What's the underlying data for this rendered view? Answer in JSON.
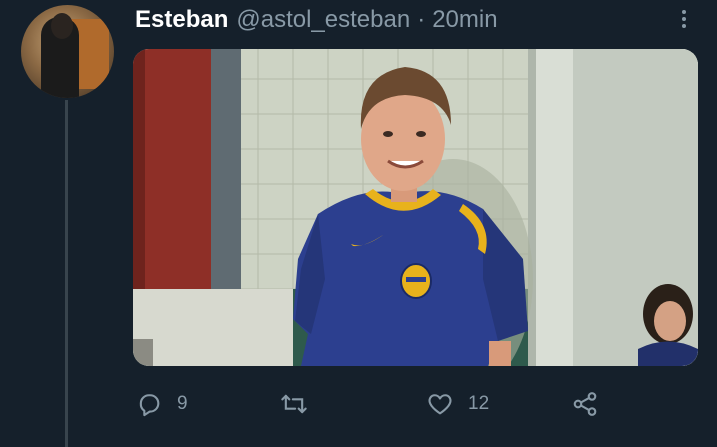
{
  "tweet": {
    "display_name": "Esteban",
    "handle": "@astol_esteban",
    "separator": "·",
    "time": "20min"
  },
  "avatar": {
    "icon": "profile-avatar"
  },
  "media": {
    "description_icon": "tweet-photo"
  },
  "actions": {
    "reply": {
      "icon": "reply-icon",
      "count": "9"
    },
    "retweet": {
      "icon": "retweet-icon",
      "count": ""
    },
    "like": {
      "icon": "heart-icon",
      "count": "12"
    },
    "share": {
      "icon": "share-icon"
    }
  },
  "colors": {
    "background": "#15202b",
    "secondary_text": "#8899a6",
    "thread_line": "#38444d",
    "jersey_blue": "#2c3f8f",
    "jersey_yellow": "#e8b21c"
  }
}
